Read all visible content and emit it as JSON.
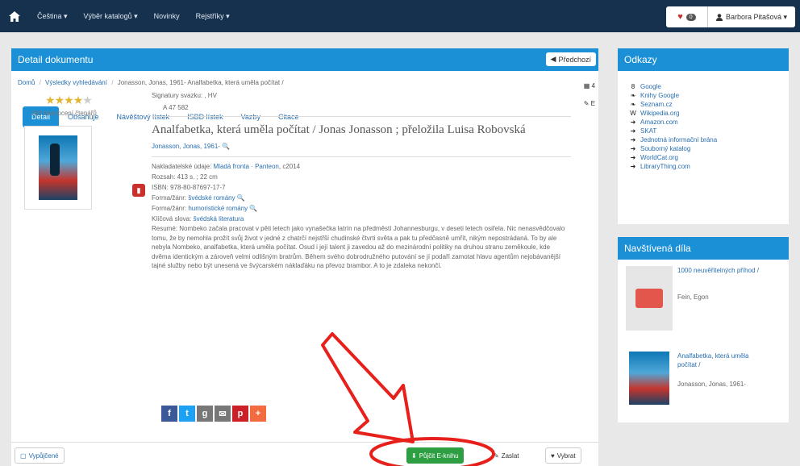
{
  "navbar": {
    "items": [
      "Čeština ▾",
      "Výběr katalogů ▾",
      "Novinky",
      "Rejstříky ▾"
    ],
    "favorites_count": "0",
    "user": "Barbora Pitašová ▾"
  },
  "main": {
    "heading": "Detail dokumentu",
    "back_label": "Předchozí",
    "breadcrumb": [
      "Domů",
      "Výsledky vyhledávání",
      "Jonasson, Jonas, 1961- Analfabetka, která uměla počítat /"
    ],
    "side_tools": [
      "4",
      "E"
    ],
    "tabs": [
      "Detail",
      "Obsahuje",
      "Návěštový lístek",
      "ISBD lístek",
      "Vazby",
      "Citace"
    ]
  },
  "rating": {
    "stars": 4,
    "max": 5,
    "count_text": "168 hodnocení čtenářů"
  },
  "record": {
    "signature_label": "Signatury svazku: , HV",
    "signature_value": "A 47 582",
    "title": "Analfabetka, která uměla počítat / Jonas Jonasson ; přeložila Luisa Robovská",
    "author": "Jonasson, Jonas, 1961-",
    "publisher_label": "Nakladatelské údaje",
    "publisher": "Mladá fronta · Panteon",
    "publisher_year": ", c2014",
    "extent": "Rozsah: 413 s. ; 22 cm",
    "isbn": "ISBN: 978-80-87697-17-7",
    "form1_label": "Forma/žánr:",
    "form1": "švédské romány",
    "form2_label": "Forma/žánr:",
    "form2": "humoristické romány",
    "keywords_label": "Klíčová slova:",
    "keywords": "švédská literatura",
    "abstract": "Resumé: Nombeko začala pracovat v pěti letech jako vynašečka latrín na předměstí Johannesburgu, v deseti letech osiřela. Nic nenasvědčovalo tomu, že by nemohla prožít svůj život v jedné z chatrčí nejstřší chudinské čtvrti světa a pak tu předčasně umřít, nikým nepostrádaná. To by ale nebyla Nombeko, analfabetka, která uměla počítat. Osud i její talent ji zavedou až do mezinárodní politiky na druhou stranu zeměkoule, kde dvěma identickým a zároveň velmi odlišným bratrům. Během svého dobrodružného putování se jí podaří zamotat hlavu agentům nejobávanější tajné služby nebo být unesená ve švýcarském náklaďáku na převoz brambor. A to je zdaleka nekončí."
  },
  "share": [
    "f",
    "t",
    "g",
    "✉",
    "p",
    "+"
  ],
  "footer": {
    "print": "Vypůjčené",
    "borrow": "Půjčit E-knihu",
    "edit": "Zaslat",
    "choose": "Vybrat"
  },
  "links": {
    "heading": "Odkazy",
    "items": [
      "Google",
      "Knihy Google",
      "Seznam.cz",
      "Wikipedia.org",
      "Amazon.com",
      "SKAT",
      "Jednotná informační brána",
      "Souborný katalog",
      "WorldCat.org",
      "LibraryThing.com"
    ]
  },
  "visited": {
    "heading": "Navštívená díla",
    "items": [
      {
        "title": "1000 neuvěřitelných příhod /",
        "author": "Fein, Egon"
      },
      {
        "title": "Analfabetka, která uměla počítat /",
        "author": "Jonasson, Jonas, 1961-"
      }
    ]
  },
  "colors": {
    "navbar": "#16314d",
    "panel_heading": "#1c90d6",
    "borrow_button": "#2e9e43",
    "annotation": "#e8201c"
  }
}
